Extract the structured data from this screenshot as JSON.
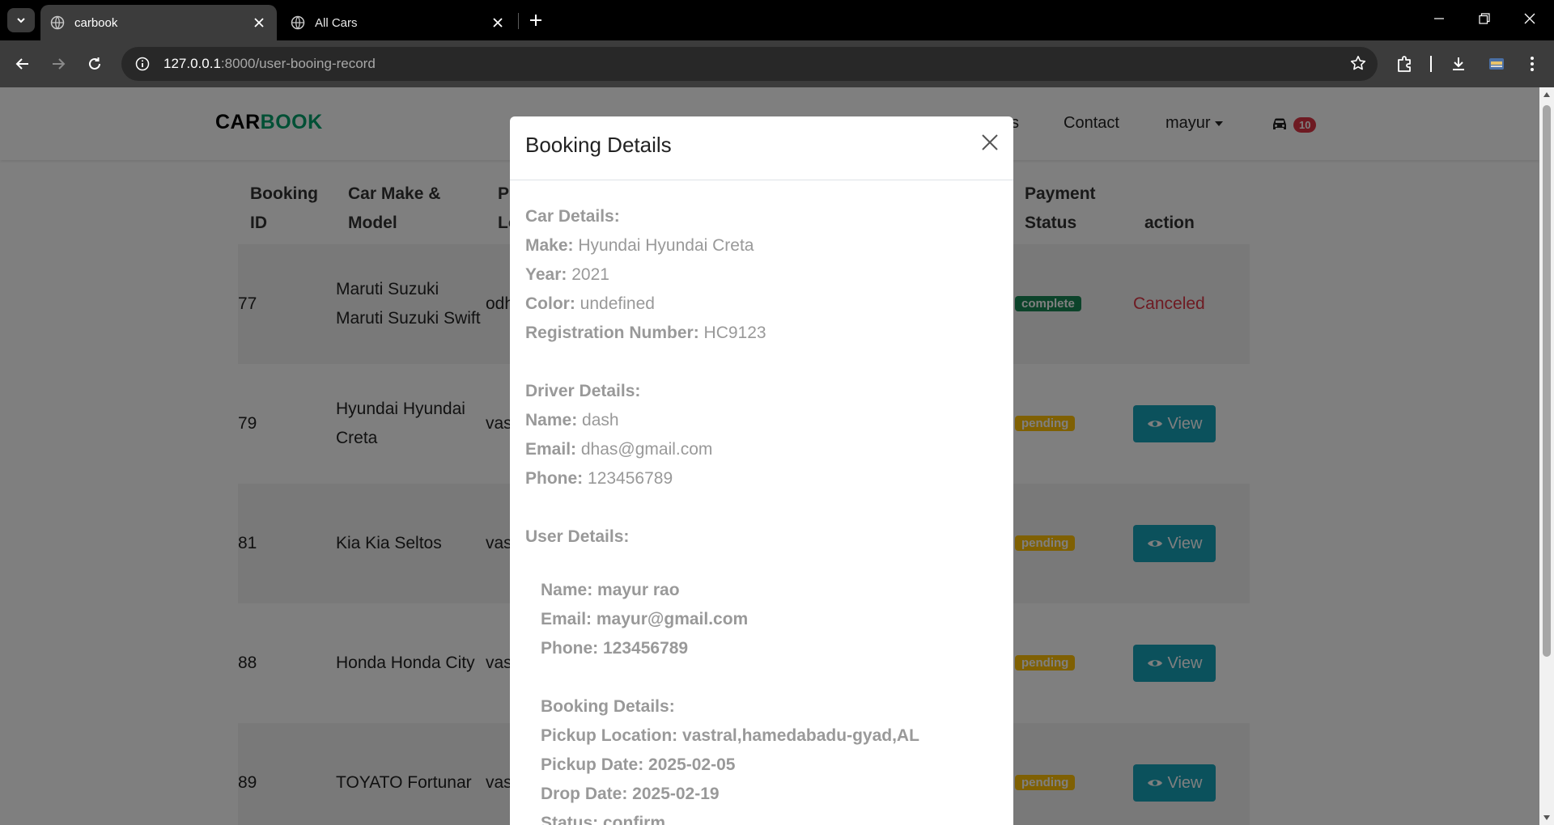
{
  "browser": {
    "tabs": [
      {
        "title": "carbook",
        "active": true
      },
      {
        "title": "All Cars",
        "active": false
      }
    ],
    "url_host": "127.0.0.1",
    "url_path": ":8000/user-booing-record"
  },
  "site": {
    "brand_part1": "CAR",
    "brand_part2": "BOOK",
    "nav": {
      "partial": "s",
      "contact": "Contact",
      "user": "mayur"
    },
    "cart_count": "10",
    "colors": {
      "brand_green": "#01a16b",
      "view_button": "#17a2b8",
      "badge_red": "#dc3545"
    }
  },
  "table": {
    "headers": {
      "booking_id_1": "Booking",
      "booking_id_2": "ID",
      "car_1": "Car Make &",
      "car_2": "Model",
      "pickup_1": "Pi",
      "pickup_2": "Lo",
      "payment_1": "Payment",
      "payment_2": "Status",
      "action": "action"
    },
    "rows": [
      {
        "id": "77",
        "car_1": "Maruti Suzuki",
        "car_2": "Maruti Suzuki Swift",
        "loc": "odh",
        "payment": "complete",
        "action": "Canceled"
      },
      {
        "id": "79",
        "car_1": "Hyundai Hyundai",
        "car_2": "Creta",
        "loc": "vas",
        "payment": "pending",
        "action": "View"
      },
      {
        "id": "81",
        "car_1": "Kia Kia Seltos",
        "car_2": "",
        "loc": "vas",
        "payment": "pending",
        "action": "View"
      },
      {
        "id": "88",
        "car_1": "Honda Honda City",
        "car_2": "",
        "loc": "vas",
        "payment": "pending",
        "action": "View"
      },
      {
        "id": "89",
        "car_1": "TOYATO Fortunar",
        "car_2": "",
        "loc": "vas",
        "payment": "pending",
        "action": "View"
      }
    ]
  },
  "modal": {
    "title": "Booking Details",
    "car_heading": "Car Details:",
    "make_label": "Make:",
    "make_value": "Hyundai Hyundai Creta",
    "year_label": "Year:",
    "year_value": "2021",
    "color_label": "Color:",
    "color_value": "undefined",
    "reg_label": "Registration Number:",
    "reg_value": "HC9123",
    "driver_heading": "Driver Details:",
    "dname_label": "Name:",
    "dname_value": "dash",
    "demail_label": "Email:",
    "demail_value": "dhas@gmail.com",
    "dphone_label": "Phone:",
    "dphone_value": "123456789",
    "user_heading": "User Details:",
    "uname": "Name: mayur rao",
    "uemail": "Email: mayur@gmail.com",
    "uphone": "Phone: 123456789",
    "booking_heading": "Booking Details:",
    "pickup_location": "Pickup Location: vastral,hamedabadu-gyad,AL",
    "pickup_date": "Pickup Date: 2025-02-05",
    "drop_date": "Drop Date: 2025-02-19",
    "status": "Status: confirm"
  }
}
